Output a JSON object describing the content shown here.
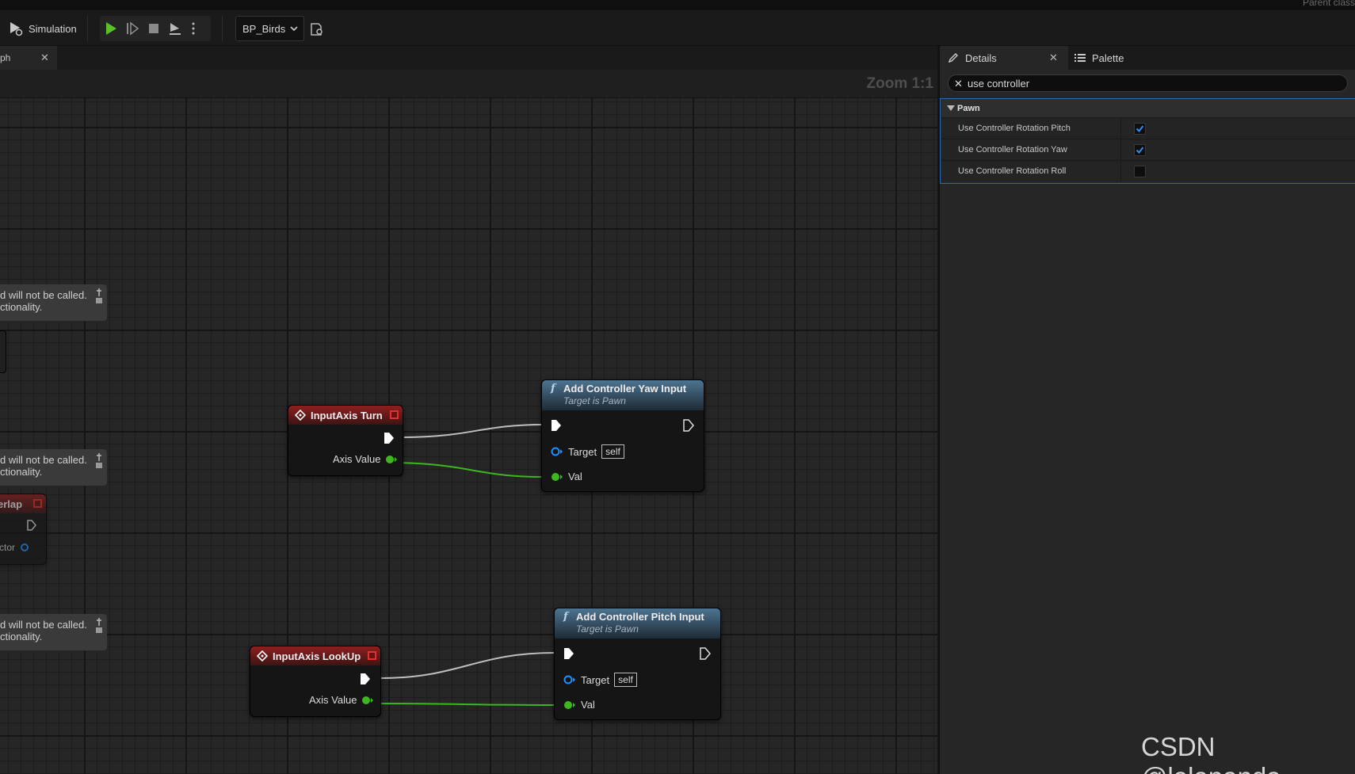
{
  "toolbar": {
    "simulation_label": "Simulation",
    "blueprint_dropdown": "BP_Birds"
  },
  "topbar": {
    "parent_class_text": "Parent class"
  },
  "graph": {
    "tab_label": "ph",
    "zoom_label": "Zoom 1:1",
    "comments": [
      {
        "line1": "d will not be called.",
        "line2": "ctionality."
      },
      {
        "line1": "d will not be called.",
        "line2": "ctionality."
      },
      {
        "line1": "d will not be called.",
        "line2": "ctionality."
      }
    ],
    "overlap_node": {
      "title": "erlap",
      "pin_label": "Actor"
    },
    "nodes": {
      "turn": {
        "title": "InputAxis Turn",
        "axis_label": "Axis Value"
      },
      "lookup": {
        "title": "InputAxis LookUp",
        "axis_label": "Axis Value"
      },
      "yaw": {
        "title": "Add Controller Yaw Input",
        "subtitle": "Target is Pawn",
        "target_label": "Target",
        "target_value": "self",
        "val_label": "Val"
      },
      "pitch": {
        "title": "Add Controller Pitch Input",
        "subtitle": "Target is Pawn",
        "target_label": "Target",
        "target_value": "self",
        "val_label": "Val"
      }
    }
  },
  "details": {
    "tab_details": "Details",
    "tab_palette": "Palette",
    "search_value": "use controller",
    "category": "Pawn",
    "properties": [
      {
        "label": "Use Controller Rotation Pitch",
        "checked": true
      },
      {
        "label": "Use Controller Rotation Yaw",
        "checked": true
      },
      {
        "label": "Use Controller Rotation Roll",
        "checked": false
      }
    ]
  },
  "watermark": "CSDN @lalapanda",
  "colors": {
    "exec_wire": "#bfbfbf",
    "float_wire": "#3cb81e",
    "event_header": "#8e1f1f",
    "function_header": "#4d7491",
    "target_pin": "#1e90ff",
    "float_pin": "#3cb81e",
    "accent_blue": "#2d6bb0"
  },
  "icons": [
    "simulation-icon",
    "play-icon",
    "frame-advance-icon",
    "stop-icon",
    "eject-icon",
    "more-options-icon",
    "chevron-down-icon",
    "debug-object-icon",
    "close-icon",
    "pencil-icon",
    "palette-list-icon",
    "clear-search-icon",
    "collapse-triangle-icon",
    "event-diamond-icon",
    "delegate-pin-icon",
    "function-icon",
    "exec-pin-icon",
    "checkmark-icon",
    "comment-pin-icon"
  ]
}
